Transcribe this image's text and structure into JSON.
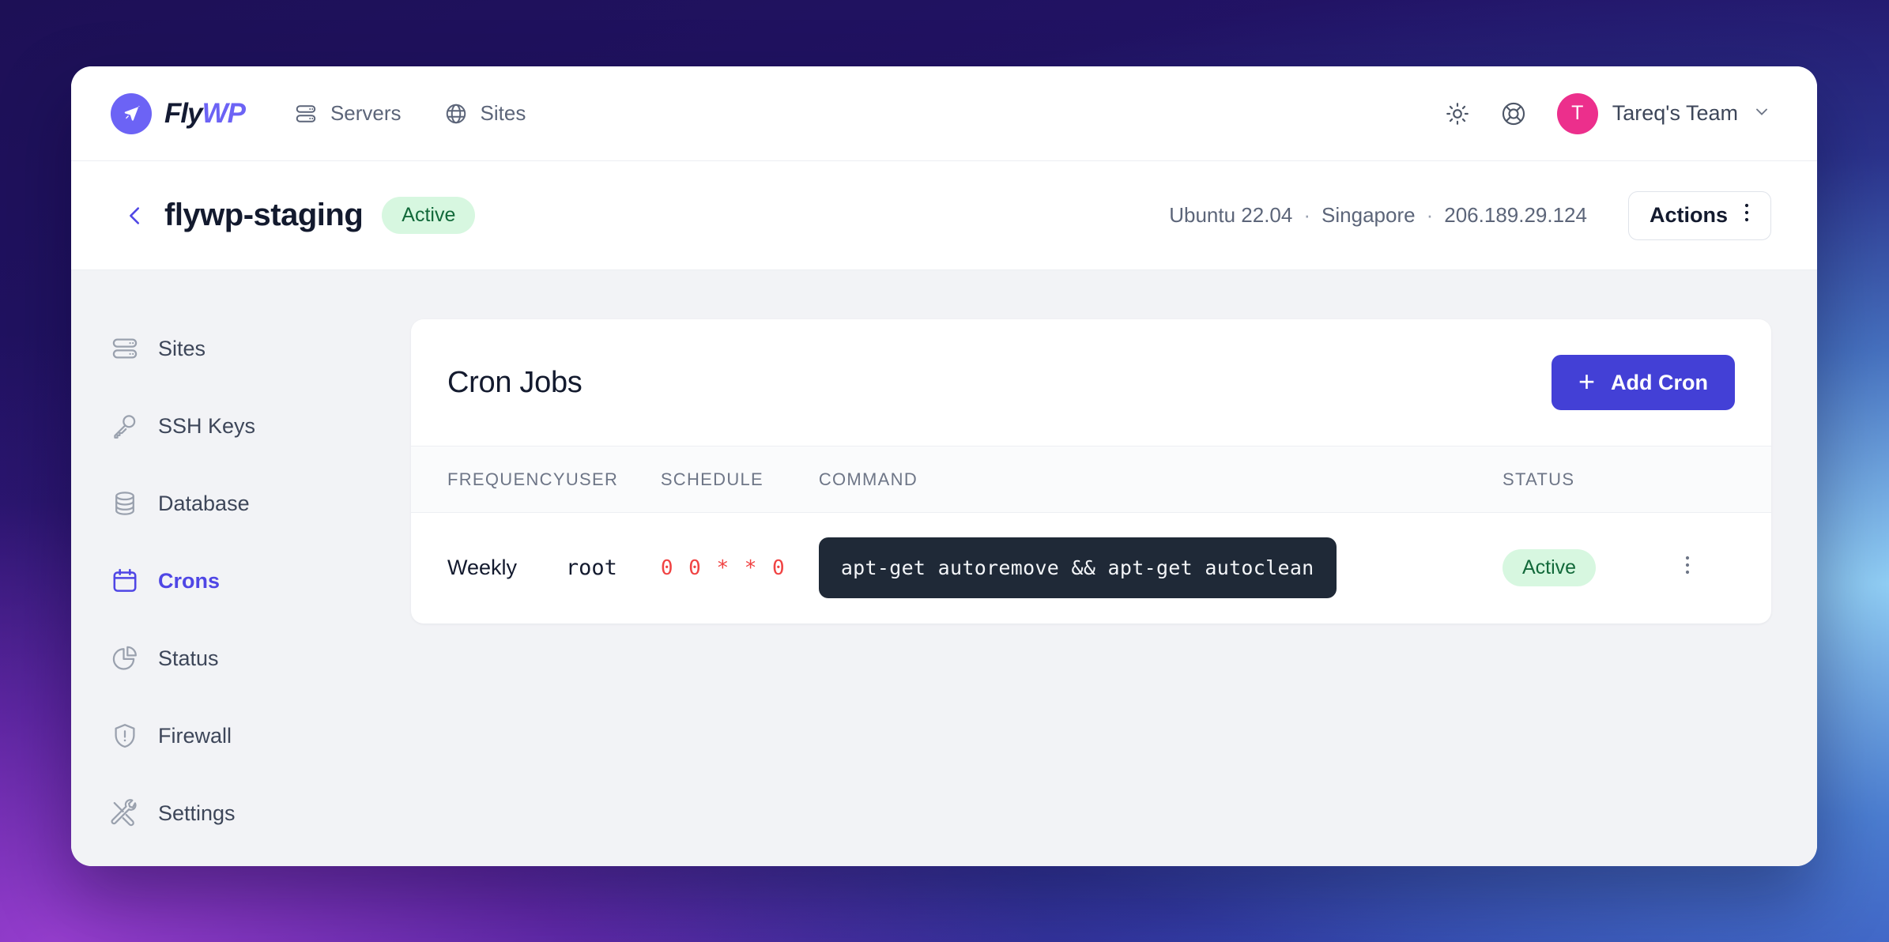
{
  "brand": {
    "name_part1": "Fly",
    "name_part2": "WP",
    "logo_icon": "paper-plane-icon"
  },
  "topnav": {
    "links": [
      {
        "label": "Servers",
        "icon": "server-stack-icon"
      },
      {
        "label": "Sites",
        "icon": "globe-icon"
      }
    ],
    "theme_toggle_icon": "sun-icon",
    "help_icon": "lifebuoy-icon",
    "team": {
      "initial": "T",
      "name": "Tareq's Team",
      "chevron_icon": "chevron-down-icon",
      "avatar_color": "#ec2f8c"
    }
  },
  "server": {
    "back_icon": "chevron-left-icon",
    "name": "flywp-staging",
    "status": "Active",
    "os": "Ubuntu 22.04",
    "region": "Singapore",
    "ip": "206.189.29.124",
    "separator": "·",
    "actions_label": "Actions",
    "actions_icon": "kebab-menu-icon"
  },
  "sidebar": {
    "items": [
      {
        "label": "Sites",
        "icon": "server-stack-icon",
        "active": false
      },
      {
        "label": "SSH Keys",
        "icon": "key-icon",
        "active": false
      },
      {
        "label": "Database",
        "icon": "database-icon",
        "active": false
      },
      {
        "label": "Crons",
        "icon": "calendar-icon",
        "active": true
      },
      {
        "label": "Status",
        "icon": "pie-chart-icon",
        "active": false
      },
      {
        "label": "Firewall",
        "icon": "shield-alert-icon",
        "active": false
      },
      {
        "label": "Settings",
        "icon": "tools-icon",
        "active": false
      }
    ]
  },
  "card": {
    "title": "Cron Jobs",
    "add_button": {
      "label": "Add Cron",
      "icon": "plus-icon"
    },
    "columns": [
      "FREQUENCY",
      "USER",
      "SCHEDULE",
      "COMMAND",
      "STATUS"
    ],
    "rows": [
      {
        "frequency": "Weekly",
        "user": "root",
        "schedule": "0 0 * * 0",
        "command": "apt-get autoremove && apt-get autoclean",
        "status": "Active",
        "menu_icon": "kebab-menu-icon"
      }
    ]
  },
  "colors": {
    "accent": "#4340d6",
    "brand": "#6c63f5",
    "active_badge_bg": "#d7f7e0",
    "active_badge_text": "#12693a",
    "schedule_text": "#f04343",
    "command_bg": "#1f2937",
    "avatar": "#ec2f8c"
  }
}
